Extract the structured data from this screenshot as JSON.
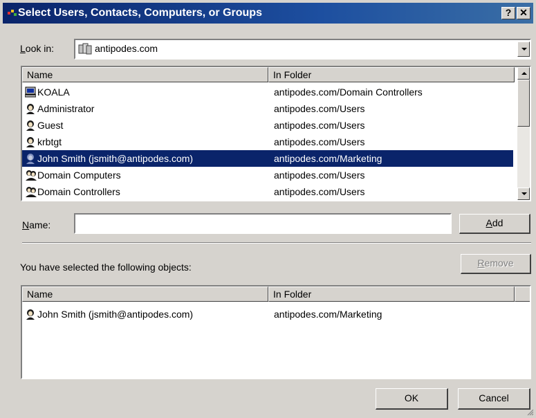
{
  "window": {
    "title": "Select Users, Contacts, Computers, or Groups"
  },
  "titlebar": {
    "help_label": "?",
    "close_label": "✕"
  },
  "look_in": {
    "label": "Look in:",
    "value": "antipodes.com"
  },
  "directory_list": {
    "columns": [
      "Name",
      "In Folder"
    ],
    "rows": [
      {
        "name": "KOALA",
        "folder": "antipodes.com/Domain Controllers",
        "icon": "computer-icon"
      },
      {
        "name": "Administrator",
        "folder": "antipodes.com/Users",
        "icon": "user-icon"
      },
      {
        "name": "Guest",
        "folder": "antipodes.com/Users",
        "icon": "user-icon"
      },
      {
        "name": "krbtgt",
        "folder": "antipodes.com/Users",
        "icon": "user-icon"
      },
      {
        "name": "John Smith (jsmith@antipodes.com)",
        "folder": "antipodes.com/Marketing",
        "icon": "user-icon",
        "selected": true
      },
      {
        "name": "Domain Computers",
        "folder": "antipodes.com/Users",
        "icon": "group-icon"
      },
      {
        "name": "Domain Controllers",
        "folder": "antipodes.com/Users",
        "icon": "group-icon"
      }
    ]
  },
  "name_field": {
    "label": "Name:",
    "value": ""
  },
  "add_button": {
    "label": "Add"
  },
  "selected_section": {
    "label": "You have selected the following objects:"
  },
  "remove_button": {
    "label": "Remove",
    "enabled": false
  },
  "selected_list": {
    "columns": [
      "Name",
      "In Folder"
    ],
    "rows": [
      {
        "name": "John Smith (jsmith@antipodes.com)",
        "folder": "antipodes.com/Marketing",
        "icon": "user-icon"
      }
    ]
  },
  "ok_button": {
    "label": "OK"
  },
  "cancel_button": {
    "label": "Cancel"
  },
  "colors": {
    "title_bar": "#0a246a",
    "selection": "#0a246a",
    "dialog_bg": "#d6d3ce"
  }
}
